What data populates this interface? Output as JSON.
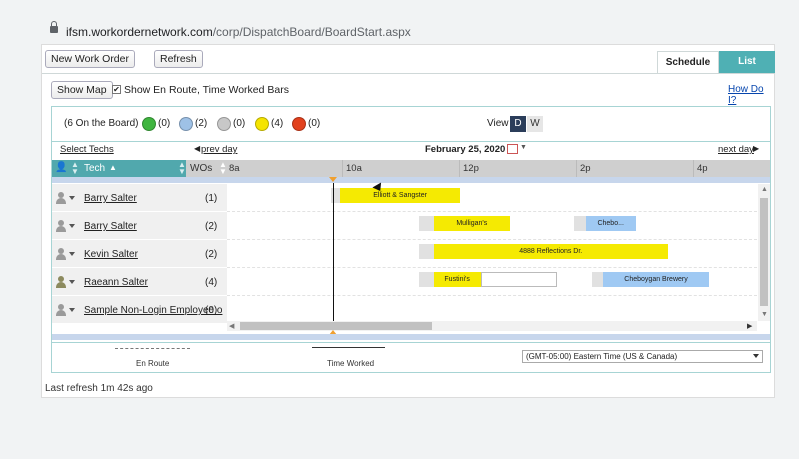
{
  "browser": {
    "url_host": "ifsm.workordernetwork.com",
    "url_path": "/corp/DispatchBoard/BoardStart.aspx"
  },
  "toolbar": {
    "new_work_order": "New Work Order",
    "refresh": "Refresh",
    "show_map": "Show Map"
  },
  "tabs": {
    "schedule": "Schedule",
    "list": "List"
  },
  "options": {
    "show_en_route": "Show En Route, Time Worked Bars",
    "show_en_route_checked": true,
    "how_do_i": "How Do I?"
  },
  "summary": {
    "on_board": "(6 On the Board)",
    "statuses": [
      {
        "color": "#3fb53f",
        "count": "(0)"
      },
      {
        "color": "#9ec1e6",
        "count": "(2)"
      },
      {
        "color": "#c8c8c8",
        "count": "(0)"
      },
      {
        "color": "#f5e400",
        "count": "(4)"
      },
      {
        "color": "#e2411d",
        "count": "(0)"
      }
    ],
    "view_label": "View",
    "view_day": "D",
    "view_week": "W",
    "view_selected": "D"
  },
  "nav": {
    "select_techs": "Select Techs",
    "prev_day": "prev day",
    "date": "February 25, 2020",
    "next_day": "next day"
  },
  "header": {
    "tech": "Tech",
    "wos": "WOs",
    "ticks": [
      "8a",
      "10a",
      "12p",
      "2p",
      "4p"
    ]
  },
  "techs": [
    {
      "name": "Barry Salter",
      "wos": "(1)",
      "appts": [
        {
          "label": "Elliott & Sangster",
          "color": "yellow",
          "start": 9.75,
          "main_start": 9.9,
          "main_end": 11.95,
          "end": 11.95
        }
      ]
    },
    {
      "name": "Barry Salter",
      "wos": "(2)",
      "appts": [
        {
          "label": "Mulligan's",
          "color": "yellow",
          "start": 11.25,
          "main_start": 11.5,
          "main_end": 12.8,
          "end": 12.8
        },
        {
          "label": "Chebo...",
          "color": "lblue",
          "start": 13.9,
          "main_start": 14.1,
          "main_end": 14.95,
          "end": 14.95
        }
      ]
    },
    {
      "name": "Kevin Salter",
      "wos": "(2)",
      "appts": [
        {
          "label": "4888 Reflections Dr.",
          "color": "yellow",
          "start": 11.25,
          "main_start": 11.5,
          "main_end": 15.5,
          "end": 15.5
        }
      ]
    },
    {
      "name": "Raeann Salter",
      "wos": "(4)",
      "appts": [
        {
          "label": "Fustini's",
          "color": "yellow",
          "start": 11.25,
          "main_start": 11.5,
          "main_end": 12.3,
          "end": 13.6
        },
        {
          "label": "Cheboygan Brewery",
          "color": "lblue",
          "start": 14.2,
          "main_start": 14.4,
          "main_end": 16.2,
          "end": 16.2
        }
      ]
    },
    {
      "name": "Sample Non-Login Employee o",
      "wos": "(0)",
      "appts": []
    }
  ],
  "legend": {
    "en_route": "En Route",
    "time_worked": "Time Worked",
    "timezone": "(GMT-05:00) Eastern Time (US & Canada)"
  },
  "last_refresh": "Last refresh 1m 42s ago"
}
